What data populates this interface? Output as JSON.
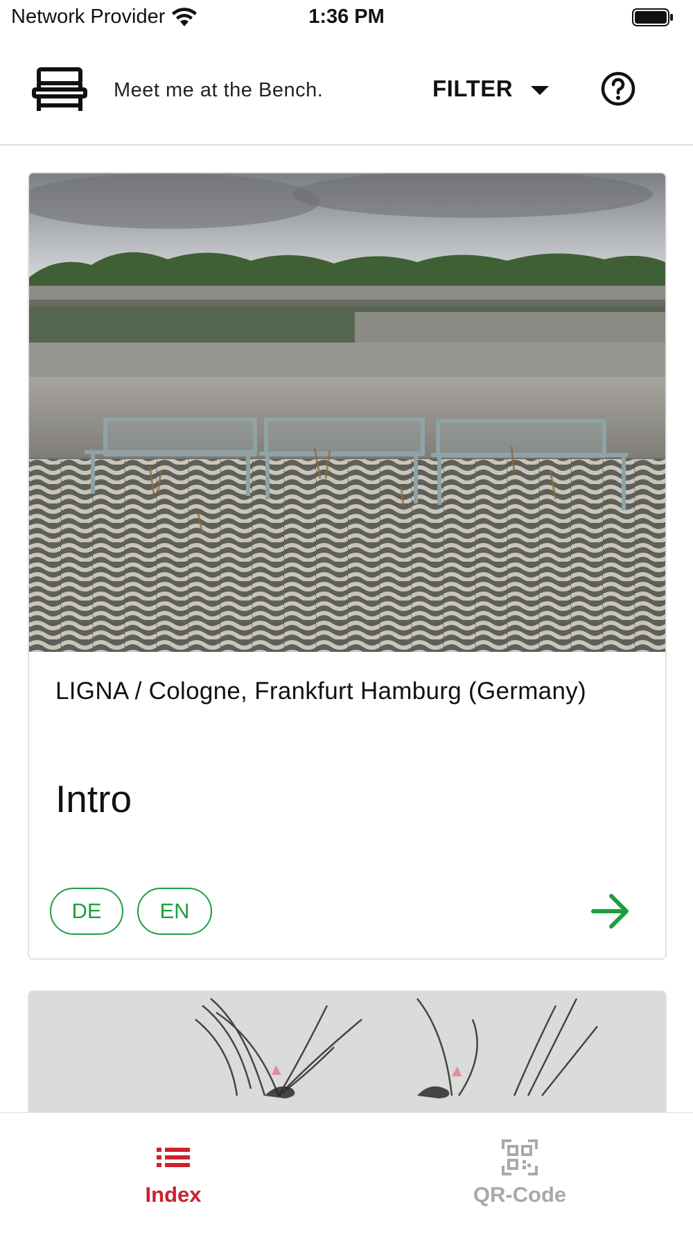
{
  "status_bar": {
    "carrier": "Network Provider",
    "time": "1:36 PM"
  },
  "header": {
    "tagline": "Meet me at the Bench.",
    "filter_label": "FILTER",
    "icons": [
      "bench-logo-icon",
      "dropdown-caret-icon",
      "help-icon"
    ]
  },
  "cards": [
    {
      "location": "LIGNA / Cologne, Frankfurt Hamburg (Germany)",
      "title": "Intro",
      "languages": [
        "DE",
        "EN"
      ],
      "image": "three metal benches on grass paving in front of a concrete wall",
      "action_icon": "arrow-right-icon"
    },
    {
      "image": "pencil drawing of birds"
    }
  ],
  "tab_bar": {
    "tabs": [
      {
        "label": "Index",
        "icon": "list-icon",
        "active": true
      },
      {
        "label": "QR-Code",
        "icon": "qr-code-icon",
        "active": false
      }
    ]
  },
  "colors": {
    "accent_green": "#1e9e3e",
    "active_tab_red": "#d0202b",
    "inactive_tab_gray": "#a9a9a9"
  }
}
